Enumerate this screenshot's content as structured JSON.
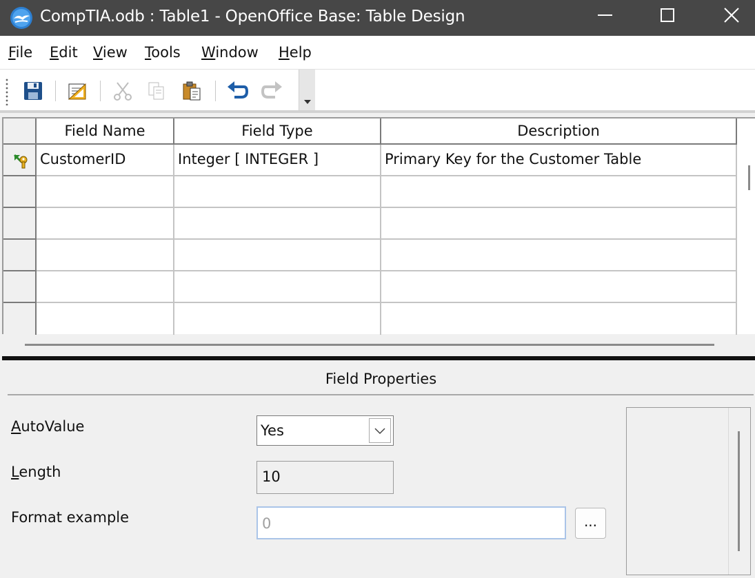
{
  "window": {
    "title": "CompTIA.odb : Table1 - OpenOffice Base: Table Design",
    "app_icon": "openoffice-gull-icon",
    "controls": [
      "minimize-icon",
      "maximize-icon",
      "close-icon"
    ]
  },
  "menu": {
    "items": [
      {
        "mnemonic": "F",
        "rest": "ile"
      },
      {
        "mnemonic": "E",
        "rest": "dit"
      },
      {
        "mnemonic": "V",
        "rest": "iew"
      },
      {
        "mnemonic": "T",
        "rest": "ools"
      },
      {
        "mnemonic": "W",
        "rest": "indow"
      },
      {
        "mnemonic": "H",
        "rest": "elp"
      }
    ]
  },
  "toolbar": {
    "buttons": [
      "save-icon",
      "edit-doc-icon",
      "cut-icon",
      "copy-icon",
      "paste-icon",
      "undo-icon",
      "redo-icon"
    ],
    "overflow": "chevron-down-icon"
  },
  "grid": {
    "columns": [
      "Field Name",
      "Field Type",
      "Description"
    ],
    "rows": [
      {
        "marker": "primary-key-icon",
        "field_name": "CustomerID",
        "field_type": "Integer [ INTEGER ]",
        "description": "Primary Key for the Customer Table"
      },
      {
        "marker": "",
        "field_name": "",
        "field_type": "",
        "description": ""
      },
      {
        "marker": "",
        "field_name": "",
        "field_type": "",
        "description": ""
      },
      {
        "marker": "",
        "field_name": "",
        "field_type": "",
        "description": ""
      },
      {
        "marker": "",
        "field_name": "",
        "field_type": "",
        "description": ""
      },
      {
        "marker": "",
        "field_name": "",
        "field_type": "",
        "description": ""
      }
    ]
  },
  "field_properties": {
    "title": "Field Properties",
    "autovalue": {
      "mnemonic": "A",
      "rest": "utoValue",
      "value": "Yes"
    },
    "length": {
      "mnemonic": "L",
      "rest": "ength",
      "value": "10"
    },
    "format_example": {
      "label": "Format example",
      "value": "0",
      "button": "..."
    }
  }
}
